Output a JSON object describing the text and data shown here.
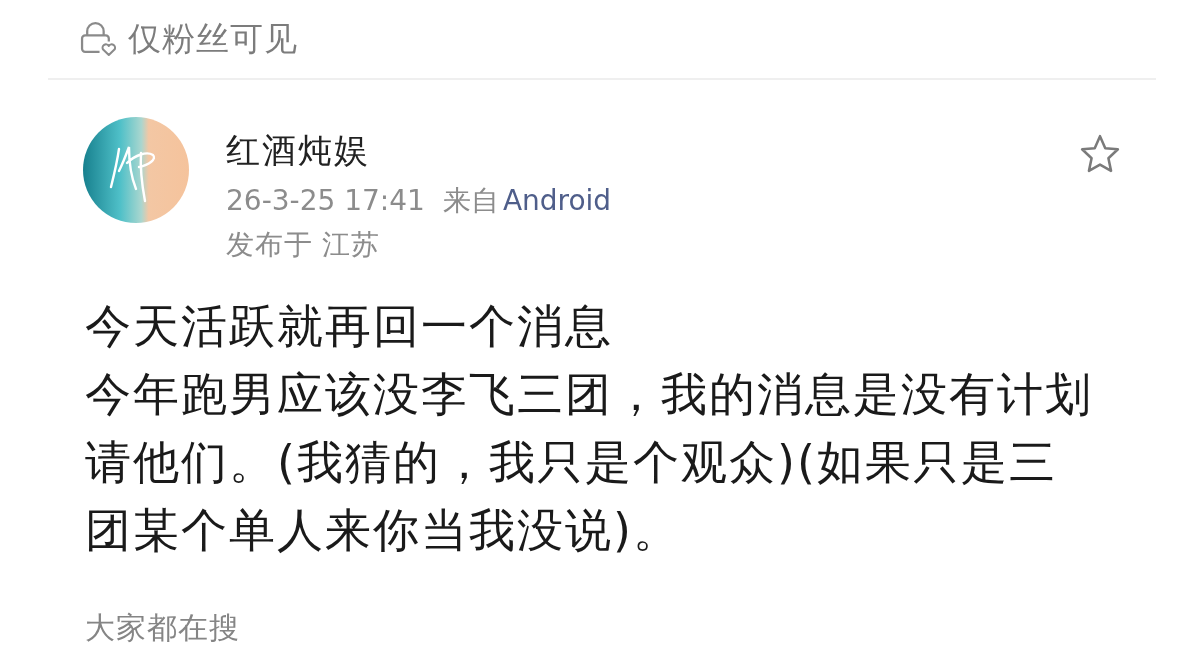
{
  "visibility": {
    "label": "仅粉丝可见"
  },
  "post": {
    "author": "红酒炖娱",
    "time": "26-3-25 17:41",
    "source_prefix": "来自",
    "source": "Android",
    "location": "发布于 江苏",
    "starred": false,
    "body": [
      "今天活跃就再回一个消息",
      "今年跑男应该没李飞三团，我的消息是没有计划请他们。(我猜的，我只是个观众)(如果只是三团某个单人来你当我没说)。"
    ]
  },
  "section_title": "大家都在搜"
}
